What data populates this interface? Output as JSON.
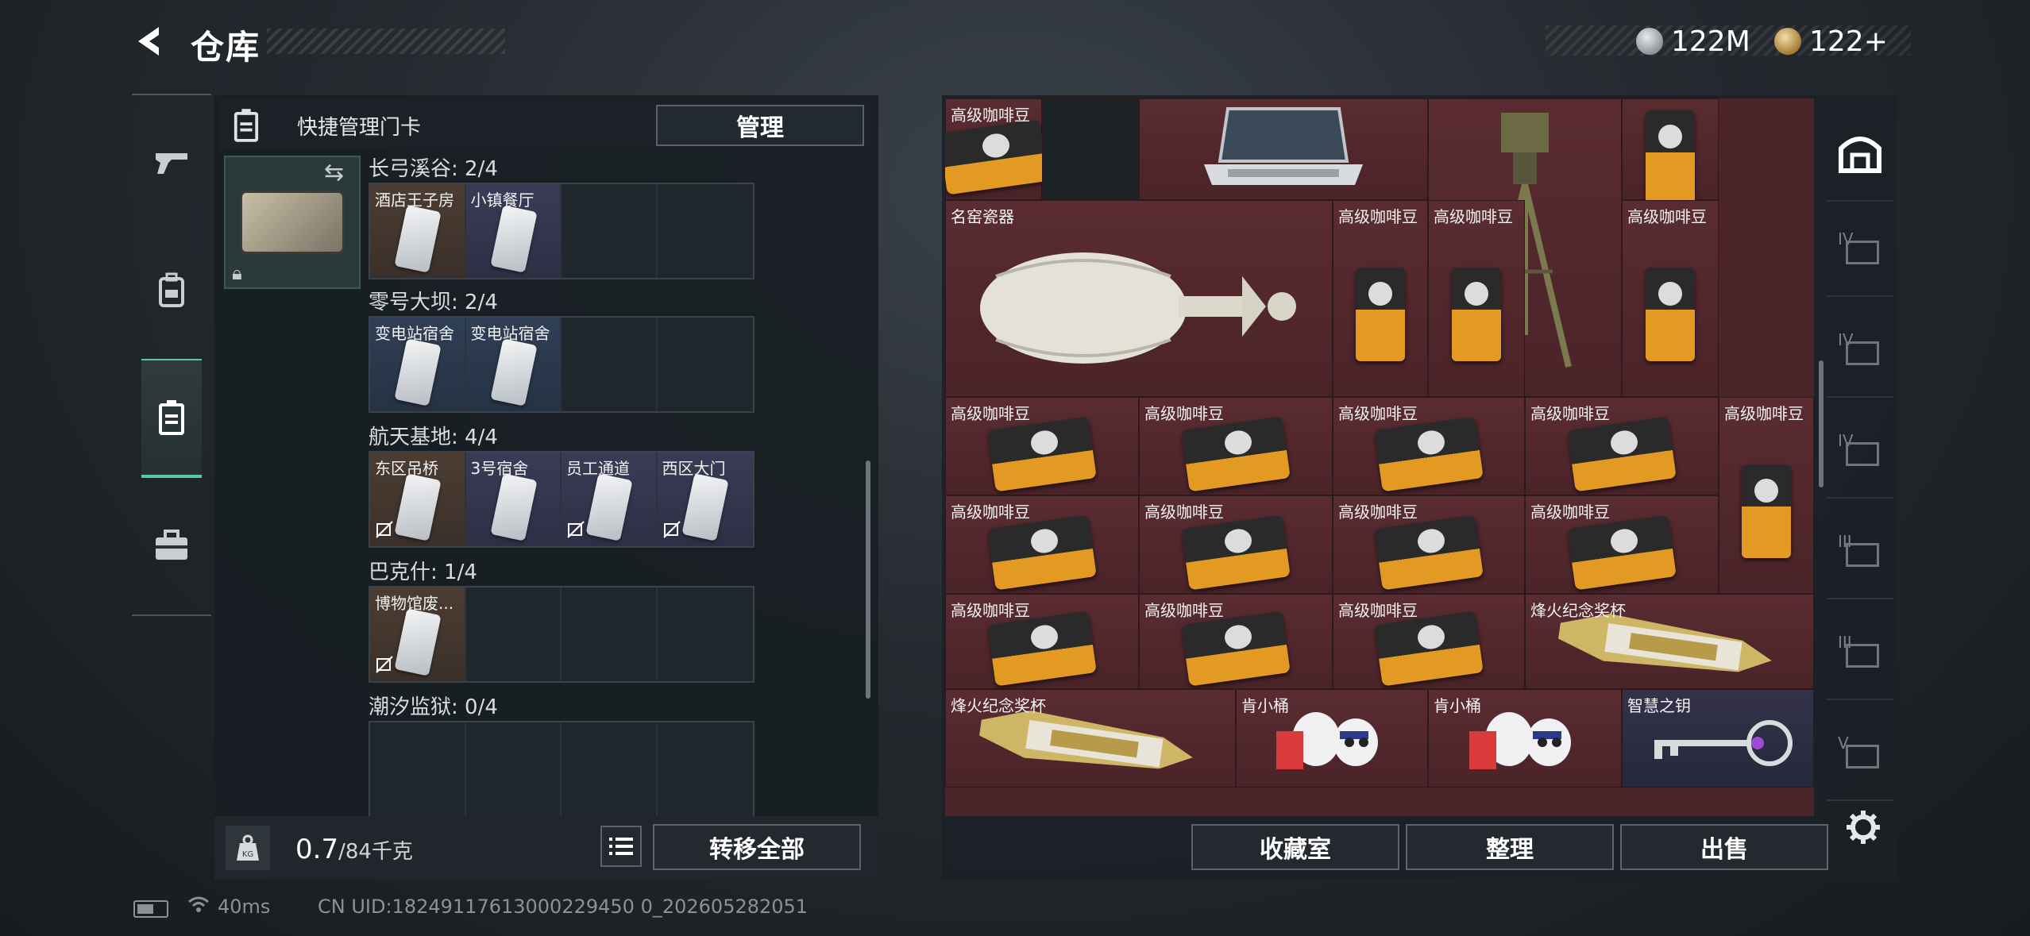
{
  "header": {
    "title": "仓库"
  },
  "currency": {
    "silver": "122M",
    "gold": "122+"
  },
  "nav": [
    {
      "icon": "pistol-icon"
    },
    {
      "icon": "backpack-icon"
    },
    {
      "icon": "keycard-holder-icon",
      "active": true
    },
    {
      "icon": "briefcase-icon"
    }
  ],
  "keycard_panel": {
    "title": "快捷管理门卡",
    "manage_label": "管理",
    "regions": [
      {
        "label": "长弓溪谷: 2/4",
        "cards": [
          {
            "name": "酒店王子房",
            "style": "brown",
            "used": false
          },
          {
            "name": "小镇餐厅",
            "style": "purple",
            "used": false
          },
          null,
          null
        ]
      },
      {
        "label": "零号大坝: 2/4",
        "cards": [
          {
            "name": "变电站宿舍",
            "style": "blue",
            "used": false
          },
          {
            "name": "变电站宿舍",
            "style": "blue",
            "used": false
          },
          null,
          null
        ]
      },
      {
        "label": "航天基地: 4/4",
        "cards": [
          {
            "name": "东区吊桥",
            "style": "brown",
            "used": true
          },
          {
            "name": "3号宿舍",
            "style": "purple",
            "used": false
          },
          {
            "name": "员工通道",
            "style": "purple",
            "used": true
          },
          {
            "name": "西区大门",
            "style": "purple",
            "used": true
          }
        ]
      },
      {
        "label": "巴克什: 1/4",
        "cards": [
          {
            "name": "博物馆废...",
            "style": "brown",
            "used": true
          },
          null,
          null,
          null
        ]
      },
      {
        "label": "潮汐监狱: 0/4",
        "cards": [
          null,
          null,
          null,
          null
        ]
      }
    ],
    "weight_value": "0.7",
    "weight_capacity": "/84千克",
    "transfer_all_label": "转移全部"
  },
  "stash": {
    "items": [
      {
        "name": "高级咖啡豆",
        "kind": "coffee-flat",
        "col": 0,
        "row": 0,
        "w": 1,
        "h": 1
      },
      {
        "name": "",
        "kind": "empty-dark",
        "col": 1,
        "row": 0,
        "w": 1,
        "h": 1
      },
      {
        "name": "",
        "kind": "laptop",
        "col": 2,
        "row": 0,
        "w": 3,
        "h": 1
      },
      {
        "name": "",
        "kind": "tripod",
        "col": 5,
        "row": 0,
        "w": 2,
        "h": 3
      },
      {
        "name": "",
        "kind": "coffee-up",
        "col": 7,
        "row": 0,
        "w": 1,
        "h": 1
      },
      {
        "name": "名窑瓷器",
        "kind": "vase",
        "col": 0,
        "row": 1,
        "w": 4,
        "h": 2
      },
      {
        "name": "高级咖啡豆",
        "kind": "coffee-up",
        "col": 4,
        "row": 1,
        "w": 1,
        "h": 2
      },
      {
        "name": "高级咖啡豆",
        "kind": "coffee-up",
        "col": 5,
        "row": 1,
        "w": 1,
        "h": 2
      },
      {
        "name": "高级咖啡豆",
        "kind": "coffee-up",
        "col": 7,
        "row": 1,
        "w": 1,
        "h": 2
      },
      {
        "name": "高级咖啡豆",
        "kind": "coffee-flat",
        "col": 0,
        "row": 3,
        "w": 2,
        "h": 1
      },
      {
        "name": "高级咖啡豆",
        "kind": "coffee-flat",
        "col": 2,
        "row": 3,
        "w": 2,
        "h": 1
      },
      {
        "name": "高级咖啡豆",
        "kind": "coffee-flat",
        "col": 4,
        "row": 3,
        "w": 2,
        "h": 1
      },
      {
        "name": "高级咖啡豆",
        "kind": "coffee-flat",
        "col": 6,
        "row": 3,
        "w": 2,
        "h": 1
      },
      {
        "name": "高级咖啡豆",
        "kind": "coffee-up",
        "col": 8,
        "row": 3,
        "w": 1,
        "h": 2
      },
      {
        "name": "高级咖啡豆",
        "kind": "coffee-flat",
        "col": 0,
        "row": 4,
        "w": 2,
        "h": 1
      },
      {
        "name": "高级咖啡豆",
        "kind": "coffee-flat",
        "col": 2,
        "row": 4,
        "w": 2,
        "h": 1
      },
      {
        "name": "高级咖啡豆",
        "kind": "coffee-flat",
        "col": 4,
        "row": 4,
        "w": 2,
        "h": 1
      },
      {
        "name": "高级咖啡豆",
        "kind": "coffee-flat",
        "col": 6,
        "row": 4,
        "w": 2,
        "h": 1
      },
      {
        "name": "高级咖啡豆",
        "kind": "coffee-flat",
        "col": 0,
        "row": 5,
        "w": 2,
        "h": 1
      },
      {
        "name": "高级咖啡豆",
        "kind": "coffee-flat",
        "col": 2,
        "row": 5,
        "w": 2,
        "h": 1
      },
      {
        "name": "高级咖啡豆",
        "kind": "coffee-flat",
        "col": 4,
        "row": 5,
        "w": 2,
        "h": 1
      },
      {
        "name": "烽火纪念奖杯",
        "kind": "trophy",
        "col": 6,
        "row": 5,
        "w": 3,
        "h": 1
      },
      {
        "name": "烽火纪念奖杯",
        "kind": "trophy",
        "col": 0,
        "row": 6,
        "w": 3,
        "h": 1
      },
      {
        "name": "肯小桶",
        "kind": "figure",
        "col": 3,
        "row": 6,
        "w": 2,
        "h": 1
      },
      {
        "name": "肯小桶",
        "kind": "figure",
        "col": 5,
        "row": 6,
        "w": 2,
        "h": 1
      },
      {
        "name": "智慧之钥",
        "kind": "key",
        "col": 7,
        "row": 6,
        "w": 2,
        "h": 1,
        "style": "purple"
      }
    ],
    "categories": [
      {
        "icon": "stash-home-icon",
        "label": "",
        "active": true
      },
      {
        "icon": "storage-iv-icon",
        "label": "IV"
      },
      {
        "icon": "storage-iv-2-icon",
        "label": "IV"
      },
      {
        "icon": "medical-iv-icon",
        "label": "IV"
      },
      {
        "icon": "storage-iii-icon",
        "label": "III"
      },
      {
        "icon": "storage-iii-2-icon",
        "label": "III"
      },
      {
        "icon": "storage-v-icon",
        "label": "V"
      }
    ],
    "buttons": {
      "collection": "收藏室",
      "sort": "整理",
      "sell": "出售"
    }
  },
  "status_bar": {
    "ping": "40ms",
    "uid": "CN UID:18249117613000229450 0_202605282051"
  },
  "colors": {
    "accent": "#5ac8a3",
    "stash_bg": "#4a2429"
  }
}
